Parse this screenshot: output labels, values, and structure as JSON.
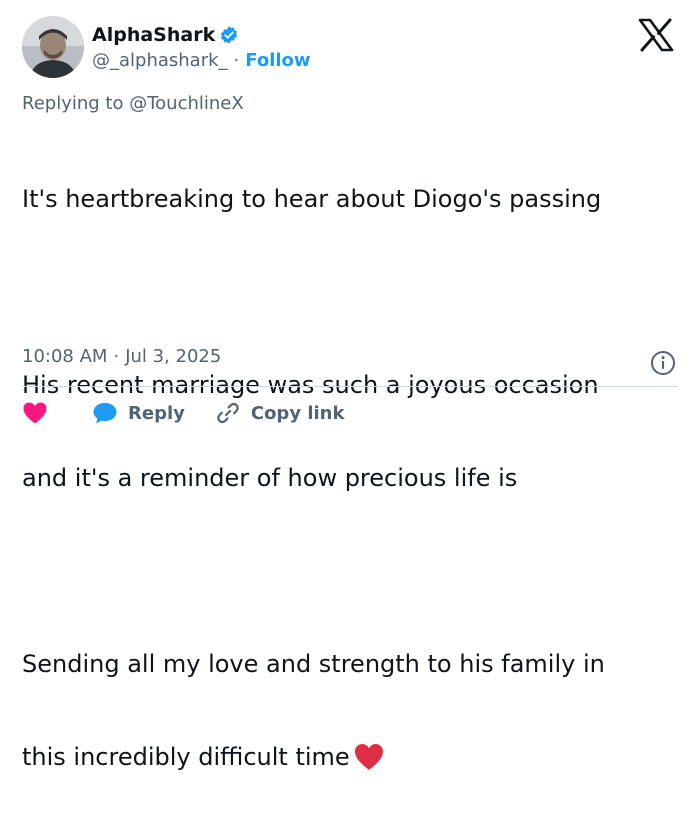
{
  "author": {
    "display_name": "AlphaShark",
    "handle": "@_alphashark_",
    "separator": "·",
    "follow_label": "Follow"
  },
  "reply": {
    "prefix": "Replying to",
    "target": "@TouchlineX"
  },
  "tweet": {
    "lines": [
      "It's heartbreaking to hear about Diogo's passing",
      "",
      "His recent marriage was such a joyous occasion",
      "and it's a reminder of how precious life is",
      "",
      "Sending all my love and strength to his family in",
      "this incredibly difficult time"
    ]
  },
  "meta": {
    "time": "10:08 AM",
    "separator": "·",
    "date": "Jul 3, 2025"
  },
  "actions": {
    "reply_label": "Reply",
    "copy_link_label": "Copy link"
  },
  "icons": {
    "verified": "verified-badge-icon",
    "logo": "x-logo-icon",
    "emoji": "red-heart-icon",
    "info": "info-icon",
    "like": "heart-icon",
    "reply": "speech-bubble-icon",
    "link": "link-icon"
  },
  "colors": {
    "text": "#0f1419",
    "secondary": "#536471",
    "accent": "#1d9bf0",
    "like": "#f91880",
    "heart_emoji": "#dd2e44",
    "divider": "#cfd9de"
  }
}
